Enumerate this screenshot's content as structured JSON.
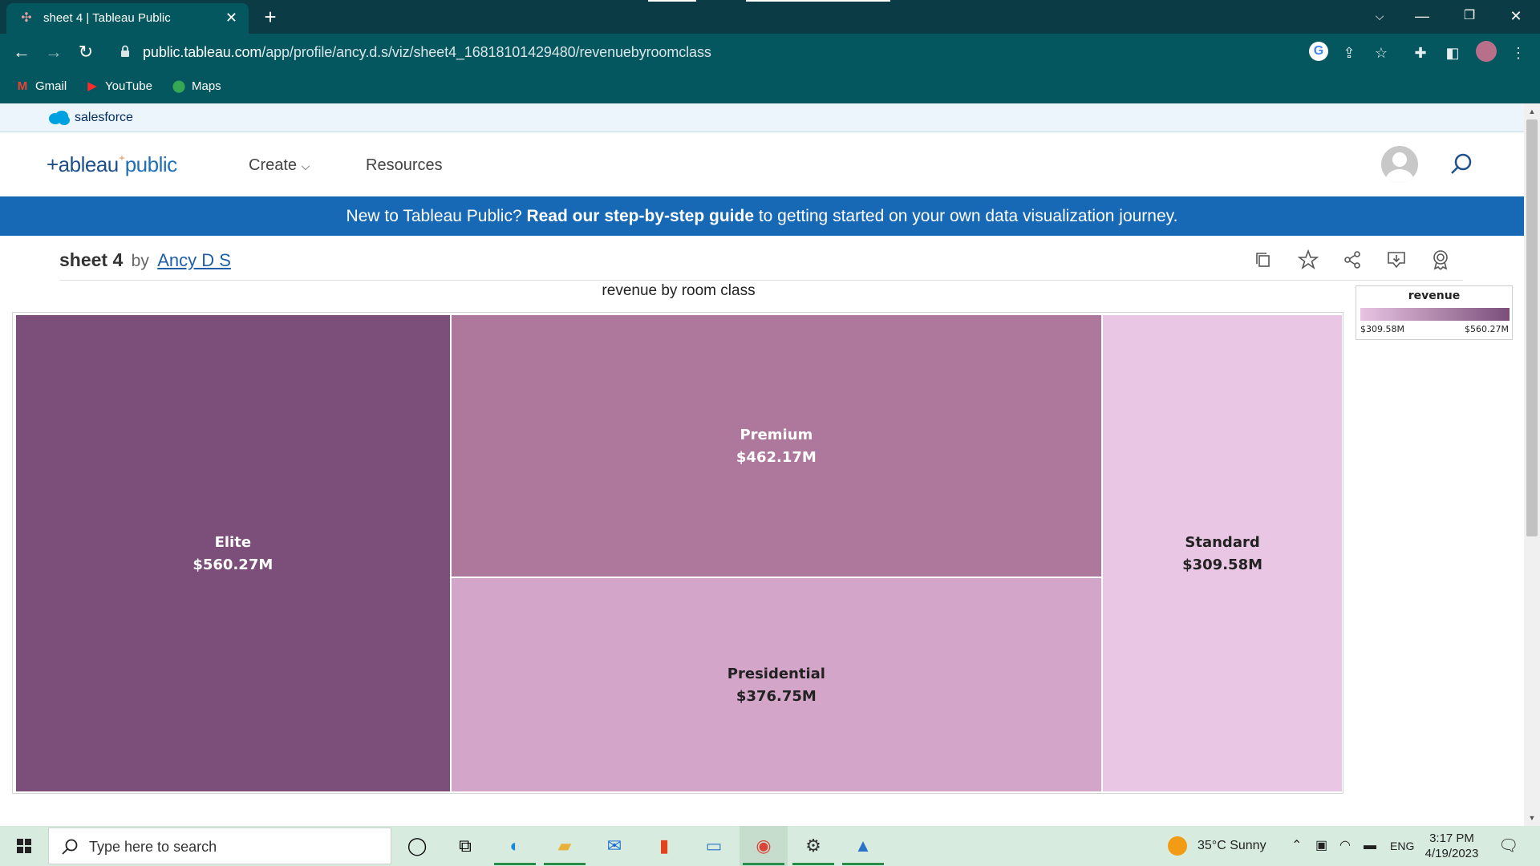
{
  "browser": {
    "tab_title": "sheet 4 | Tableau Public",
    "url_host": "public.tableau.com",
    "url_path": "/app/profile/ancy.d.s/viz/sheet4_16818101429480/revenuebyroomclass",
    "bookmarks": [
      {
        "label": "Gmail",
        "icon": "gmail-icon"
      },
      {
        "label": "YouTube",
        "icon": "youtube-icon"
      },
      {
        "label": "Maps",
        "icon": "maps-icon"
      }
    ]
  },
  "site": {
    "salesforce_label": "salesforce",
    "logo_text_a": "+ableau",
    "logo_text_b": "public",
    "nav_create": "Create",
    "nav_resources": "Resources",
    "banner_pre": "New to Tableau Public? ",
    "banner_bold": "Read our step-by-step guide",
    "banner_post": " to getting started on your own data visualization journey."
  },
  "viz": {
    "title": "sheet 4",
    "by": "by",
    "author": "Ancy D S"
  },
  "chart_data": {
    "type": "treemap",
    "title": "revenue by room class",
    "legend": {
      "title": "revenue",
      "min_label": "$309.58M",
      "max_label": "$560.27M",
      "min_color": "#e8c4e2",
      "max_color": "#7b4f7a"
    },
    "items": [
      {
        "name": "Elite",
        "value": 560.27,
        "label": "$560.27M",
        "color": "#7b4f7a",
        "text_color": "#ffffff"
      },
      {
        "name": "Premium",
        "value": 462.17,
        "label": "$462.17M",
        "color": "#ae789d",
        "text_color": "#ffffff"
      },
      {
        "name": "Presidential",
        "value": 376.75,
        "label": "$376.75M",
        "color": "#d3a5c8",
        "text_color": "#222222"
      },
      {
        "name": "Standard",
        "value": 309.58,
        "label": "$309.58M",
        "color": "#e9c6e4",
        "text_color": "#222222"
      }
    ]
  },
  "taskbar": {
    "search_placeholder": "Type here to search",
    "weather": "35°C  Sunny",
    "lang": "ENG",
    "time": "3:17 PM",
    "date": "4/19/2023"
  }
}
